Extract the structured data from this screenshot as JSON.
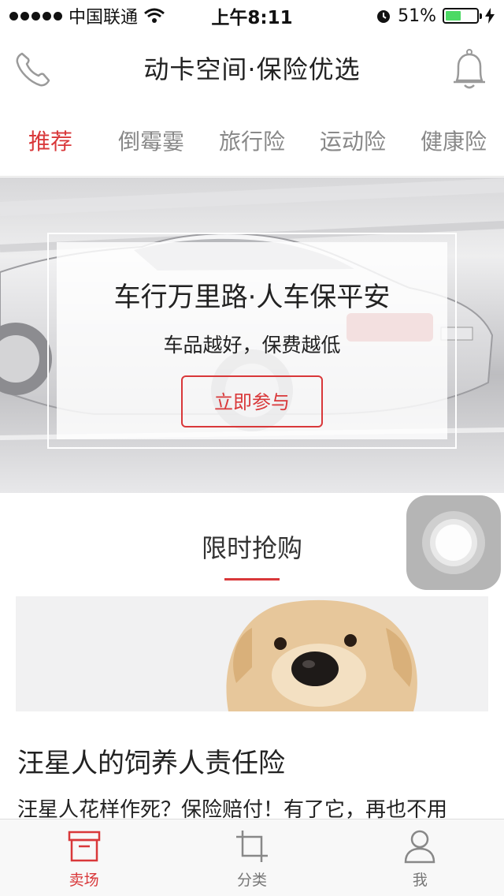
{
  "status_bar": {
    "carrier": "中国联通",
    "time": "上午8:11",
    "battery_percent": "51%",
    "battery_level": 0.51
  },
  "header": {
    "title": "动卡空间·保险优选",
    "left_icon": "phone-icon",
    "right_icon": "bell-icon"
  },
  "tabs": [
    {
      "label": "推荐",
      "active": true
    },
    {
      "label": "倒霉霎",
      "active": false
    },
    {
      "label": "旅行险",
      "active": false
    },
    {
      "label": "运动险",
      "active": false
    },
    {
      "label": "健康险",
      "active": false
    }
  ],
  "banner": {
    "title": "车行万里路·人车保平安",
    "subtitle": "车品越好，保费越低",
    "button": "立即参与"
  },
  "section": {
    "title": "限时抢购"
  },
  "product": {
    "title": "汪星人的饲养人责任险",
    "description": "汪星人花样作死？保险赔付！有了它，再也不用"
  },
  "tab_bar": [
    {
      "label": "卖场",
      "icon": "store-box-icon",
      "active": true
    },
    {
      "label": "分类",
      "icon": "crop-icon",
      "active": false
    },
    {
      "label": "我",
      "icon": "person-icon",
      "active": false
    }
  ],
  "colors": {
    "accent": "#d9383a",
    "battery": "#4cd964"
  }
}
